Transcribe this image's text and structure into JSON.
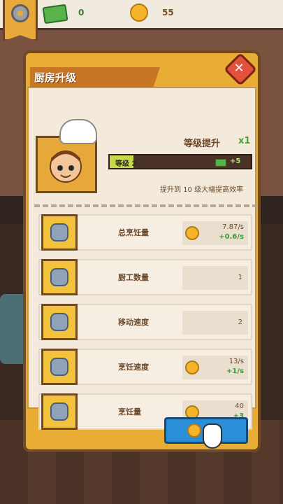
{
  "hud": {
    "cash_value": "0",
    "coin_value": "55",
    "icons": [
      "gear-icon",
      "cash-icon",
      "coin-icon"
    ]
  },
  "dialog": {
    "title": "厨房升级",
    "close_icon": "close-icon",
    "level_title": "等级提升",
    "level_multiplier": "x1",
    "level_label": "等级 2",
    "level_bonus": "+5",
    "tip": "提升到 10 级大幅提高效率"
  },
  "rows": [
    {
      "label": "总烹饪量",
      "main": "7.87/s",
      "delta": "+0.6/s",
      "icon": "chef-icon"
    },
    {
      "label": "厨工数量",
      "main": "1",
      "icon": "chef-icon"
    },
    {
      "label": "移动速度",
      "main": "2",
      "icon": "boot-icon"
    },
    {
      "label": "烹饪速度",
      "main": "13/s",
      "delta": "+1/s",
      "icon": "pot-icon"
    },
    {
      "label": "烹饪量",
      "main": "40",
      "delta": "+3",
      "icon": "pot-icon"
    }
  ],
  "colors": {
    "panel": "#e9ad35",
    "accent_green": "#4aa43a",
    "button_blue": "#2a8fd8"
  }
}
